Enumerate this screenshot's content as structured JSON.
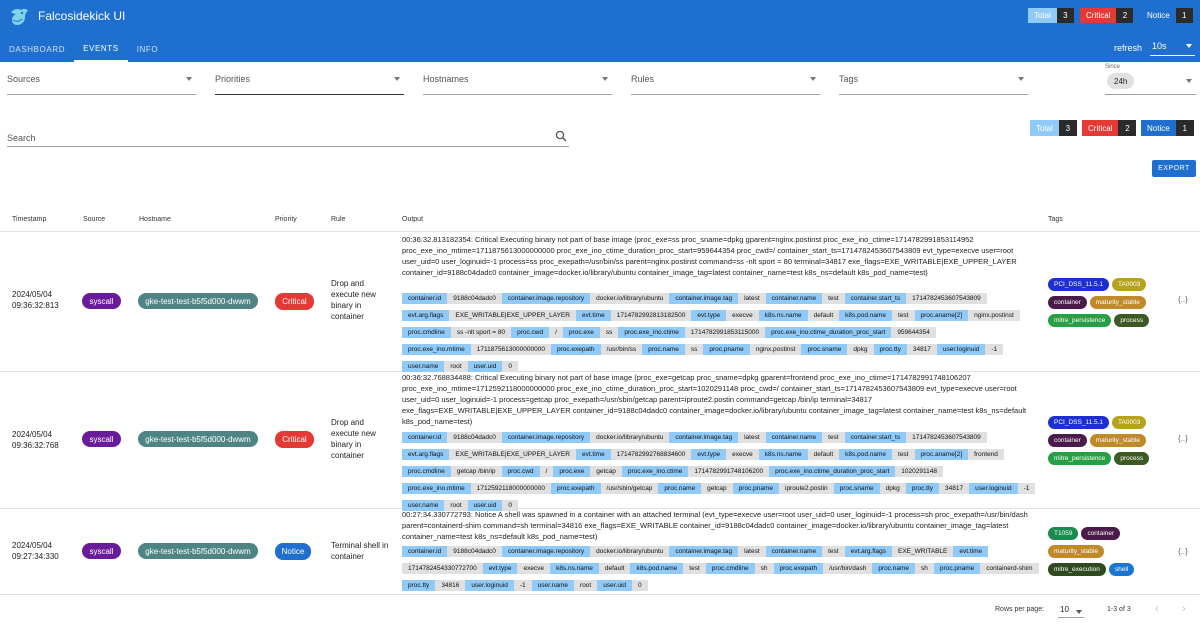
{
  "app": {
    "title": "Falcosidekick UI"
  },
  "header_counters": [
    {
      "label": "Total",
      "count": "3",
      "color": "#90caf9"
    },
    {
      "label": "Critical",
      "count": "2",
      "color": "#e53935"
    },
    {
      "label": "Notice",
      "count": "1",
      "color": "#1f6fcf"
    }
  ],
  "nav": {
    "tabs": [
      "DASHBOARD",
      "EVENTS",
      "INFO"
    ],
    "active": "EVENTS"
  },
  "refresh": {
    "label": "refresh",
    "value": "10s"
  },
  "filters": {
    "sources": "Sources",
    "priorities": "Priorities",
    "hostnames": "Hostnames",
    "rules": "Rules",
    "tags": "Tags",
    "since_label": "Since",
    "since_value": "24h"
  },
  "search": {
    "placeholder": "Search"
  },
  "summary_counters": [
    {
      "label": "Total",
      "count": "3",
      "color": "#90caf9"
    },
    {
      "label": "Critical",
      "count": "2",
      "color": "#e53935"
    },
    {
      "label": "Notice",
      "count": "1",
      "color": "#1f6fcf"
    }
  ],
  "export_label": "EXPORT",
  "table": {
    "headers": [
      "Timestamp",
      "Source",
      "Hostname",
      "Priority",
      "Rule",
      "Output",
      "Tags"
    ],
    "rows": [
      {
        "date": "2024/05/04",
        "time": "09:36:32:813",
        "source": "syscall",
        "hostname": "gke-test-test-b5f5d000-dwwm",
        "priority": "Critical",
        "priority_color": "#e53935",
        "rule": "Drop and execute new binary in container",
        "output": "00:36:32.813182354: Critical Executing binary not part of base image (proc_exe=ss proc_sname=dpkg gparent=nginx.postinst proc_exe_ino_ctime=1714782991853114952 proc_exe_ino_mtime=1711875613000000000 proc_exe_ino_ctime_duration_proc_start=959644354 proc_cwd=/ container_start_ts=1714782453607543809 evt_type=execve user=root user_uid=0 user_loginuid=-1 process=ss proc_exepath=/usr/bin/ss parent=nginx.postinst command=ss -nlt sport = 80 terminal=34817 exe_flags=EXE_WRITABLE|EXE_UPPER_LAYER container_id=9188c04dadc0 container_image=docker.io/library/ubuntu container_image_tag=latest container_name=test k8s_ns=default k8s_pod_name=test)",
        "fields": [
          [
            "container.id",
            "9188c04dadc0"
          ],
          [
            "container.image.repository",
            "docker.io/library/ubuntu"
          ],
          [
            "container.image.tag",
            "latest"
          ],
          [
            "container.name",
            "test"
          ],
          [
            "container.start_ts",
            "1714782453607543809"
          ],
          [
            "evt.arg.flags",
            "EXE_WRITABLE|EXE_UPPER_LAYER"
          ],
          [
            "evt.time",
            "1714782992813182500"
          ],
          [
            "evt.type",
            "execve"
          ],
          [
            "k8s.ns.name",
            "default"
          ],
          [
            "k8s.pod.name",
            "test"
          ],
          [
            "proc.aname[2]",
            "nginx.postinst"
          ],
          [
            "proc.cmdline",
            "ss -nlt sport = 80"
          ],
          [
            "proc.cwd",
            "/"
          ],
          [
            "proc.exe",
            "ss"
          ],
          [
            "proc.exe_ino.ctime",
            "1714782991853115000"
          ],
          [
            "proc.exe_ino.ctime_duration_proc_start",
            "959644354"
          ],
          [
            "proc.exe_ino.mtime",
            "1711875613000000000"
          ],
          [
            "proc.exepath",
            "/usr/bin/ss"
          ],
          [
            "proc.name",
            "ss"
          ],
          [
            "proc.pname",
            "nginx.postinst"
          ],
          [
            "proc.sname",
            "dpkg"
          ],
          [
            "proc.tty",
            "34817"
          ],
          [
            "user.loginuid",
            "-1"
          ],
          [
            "user.name",
            "root"
          ],
          [
            "user.uid",
            "0"
          ]
        ],
        "tags": [
          {
            "text": "PCI_DSS_11.5.1",
            "color": "#1e2fd0"
          },
          {
            "text": "TA0003",
            "color": "#b5a31d"
          },
          {
            "text": "container",
            "color": "#4a1a4a"
          },
          {
            "text": "maturity_stable",
            "color": "#c08a2a"
          },
          {
            "text": "mitre_persistence",
            "color": "#27a045"
          },
          {
            "text": "process",
            "color": "#3d5a24"
          }
        ]
      },
      {
        "date": "2024/05/04",
        "time": "09:36:32:768",
        "source": "syscall",
        "hostname": "gke-test-test-b5f5d000-dwwm",
        "priority": "Critical",
        "priority_color": "#e53935",
        "rule": "Drop and execute new binary in container",
        "output": "00:36:32.768834488: Critical Executing binary not part of base image (proc_exe=getcap proc_sname=dpkg gparent=frontend proc_exe_ino_ctime=1714782991748106207 proc_exe_ino_mtime=1712592118000000000 proc_exe_ino_ctime_duration_proc_start=1020291148 proc_cwd=/ container_start_ts=1714782453607543809 evt_type=execve user=root user_uid=0 user_loginuid=-1 process=getcap proc_exepath=/usr/sbin/getcap parent=iproute2.postin command=getcap /bin/ip terminal=34817 exe_flags=EXE_WRITABLE|EXE_UPPER_LAYER container_id=9188c04dadc0 container_image=docker.io/library/ubuntu container_image_tag=latest container_name=test k8s_ns=default k8s_pod_name=test)",
        "fields": [
          [
            "container.id",
            "9188c04dadc0"
          ],
          [
            "container.image.repository",
            "docker.io/library/ubuntu"
          ],
          [
            "container.image.tag",
            "latest"
          ],
          [
            "container.name",
            "test"
          ],
          [
            "container.start_ts",
            "1714782453607543809"
          ],
          [
            "evt.arg.flags",
            "EXE_WRITABLE|EXE_UPPER_LAYER"
          ],
          [
            "evt.time",
            "1714782992768834600"
          ],
          [
            "evt.type",
            "execve"
          ],
          [
            "k8s.ns.name",
            "default"
          ],
          [
            "k8s.pod.name",
            "test"
          ],
          [
            "proc.aname[2]",
            "frontend"
          ],
          [
            "proc.cmdline",
            "getcap /bin/ip"
          ],
          [
            "proc.cwd",
            "/"
          ],
          [
            "proc.exe",
            "getcap"
          ],
          [
            "proc.exe_ino.ctime",
            "1714782991748106200"
          ],
          [
            "proc.exe_ino.ctime_duration_proc_start",
            "1020291148"
          ],
          [
            "proc.exe_ino.mtime",
            "1712592118000000000"
          ],
          [
            "proc.exepath",
            "/usr/sbin/getcap"
          ],
          [
            "proc.name",
            "getcap"
          ],
          [
            "proc.pname",
            "iproute2.postin"
          ],
          [
            "proc.sname",
            "dpkg"
          ],
          [
            "proc.tty",
            "34817"
          ],
          [
            "user.loginuid",
            "-1"
          ],
          [
            "user.name",
            "root"
          ],
          [
            "user.uid",
            "0"
          ]
        ],
        "tags": [
          {
            "text": "PCI_DSS_11.5.1",
            "color": "#1e2fd0"
          },
          {
            "text": "TA0003",
            "color": "#b5a31d"
          },
          {
            "text": "container",
            "color": "#4a1a4a"
          },
          {
            "text": "maturity_stable",
            "color": "#c08a2a"
          },
          {
            "text": "mitre_persistence",
            "color": "#27a045"
          },
          {
            "text": "process",
            "color": "#3d5a24"
          }
        ]
      },
      {
        "date": "2024/05/04",
        "time": "09:27:34:330",
        "source": "syscall",
        "hostname": "gke-test-test-b5f5d000-dwwm",
        "priority": "Notice",
        "priority_color": "#1f6fcf",
        "rule": "Terminal shell in container",
        "output": "00:27:34.330772793: Notice A shell was spawned in a container with an attached terminal (evt_type=execve user=root user_uid=0 user_loginuid=-1 process=sh proc_exepath=/usr/bin/dash parent=containerd-shim command=sh terminal=34816 exe_flags=EXE_WRITABLE container_id=9188c04dadc0 container_image=docker.io/library/ubuntu container_image_tag=latest container_name=test k8s_ns=default k8s_pod_name=test)",
        "fields": [
          [
            "container.id",
            "9188c04dadc0"
          ],
          [
            "container.image.repository",
            "docker.io/library/ubuntu"
          ],
          [
            "container.image.tag",
            "latest"
          ],
          [
            "container.name",
            "test"
          ],
          [
            "evt.arg.flags",
            "EXE_WRITABLE"
          ],
          [
            "evt.time",
            ""
          ],
          [
            "",
            "1714782454330772700"
          ],
          [
            "evt.type",
            "execve"
          ],
          [
            "k8s.ns.name",
            "default"
          ],
          [
            "k8s.pod.name",
            "test"
          ],
          [
            "proc.cmdline",
            "sh"
          ],
          [
            "proc.exepath",
            "/usr/bin/dash"
          ],
          [
            "proc.name",
            "sh"
          ],
          [
            "proc.pname",
            ""
          ],
          [
            "",
            "containerd-shim"
          ],
          [
            "proc.tty",
            "34816"
          ],
          [
            "user.loginuid",
            "-1"
          ],
          [
            "user.name",
            "root"
          ],
          [
            "user.uid",
            "0"
          ]
        ],
        "tags": [
          {
            "text": "T1059",
            "color": "#1a8a4e"
          },
          {
            "text": "container",
            "color": "#4a1a4a"
          },
          {
            "text": "maturity_stable",
            "color": "#c08a2a"
          },
          {
            "text": "mitre_execution",
            "color": "#2e4a1e"
          },
          {
            "text": "shell",
            "color": "#1976d2"
          }
        ]
      }
    ]
  },
  "json_button": "{..}",
  "pagination": {
    "rows_per_page_label": "Rows per page:",
    "rows_per_page": "10",
    "range": "1-3 of 3",
    "prev": "‹",
    "next": "›"
  },
  "icons": {
    "search": "search-icon",
    "logo": "falco-logo-icon"
  }
}
